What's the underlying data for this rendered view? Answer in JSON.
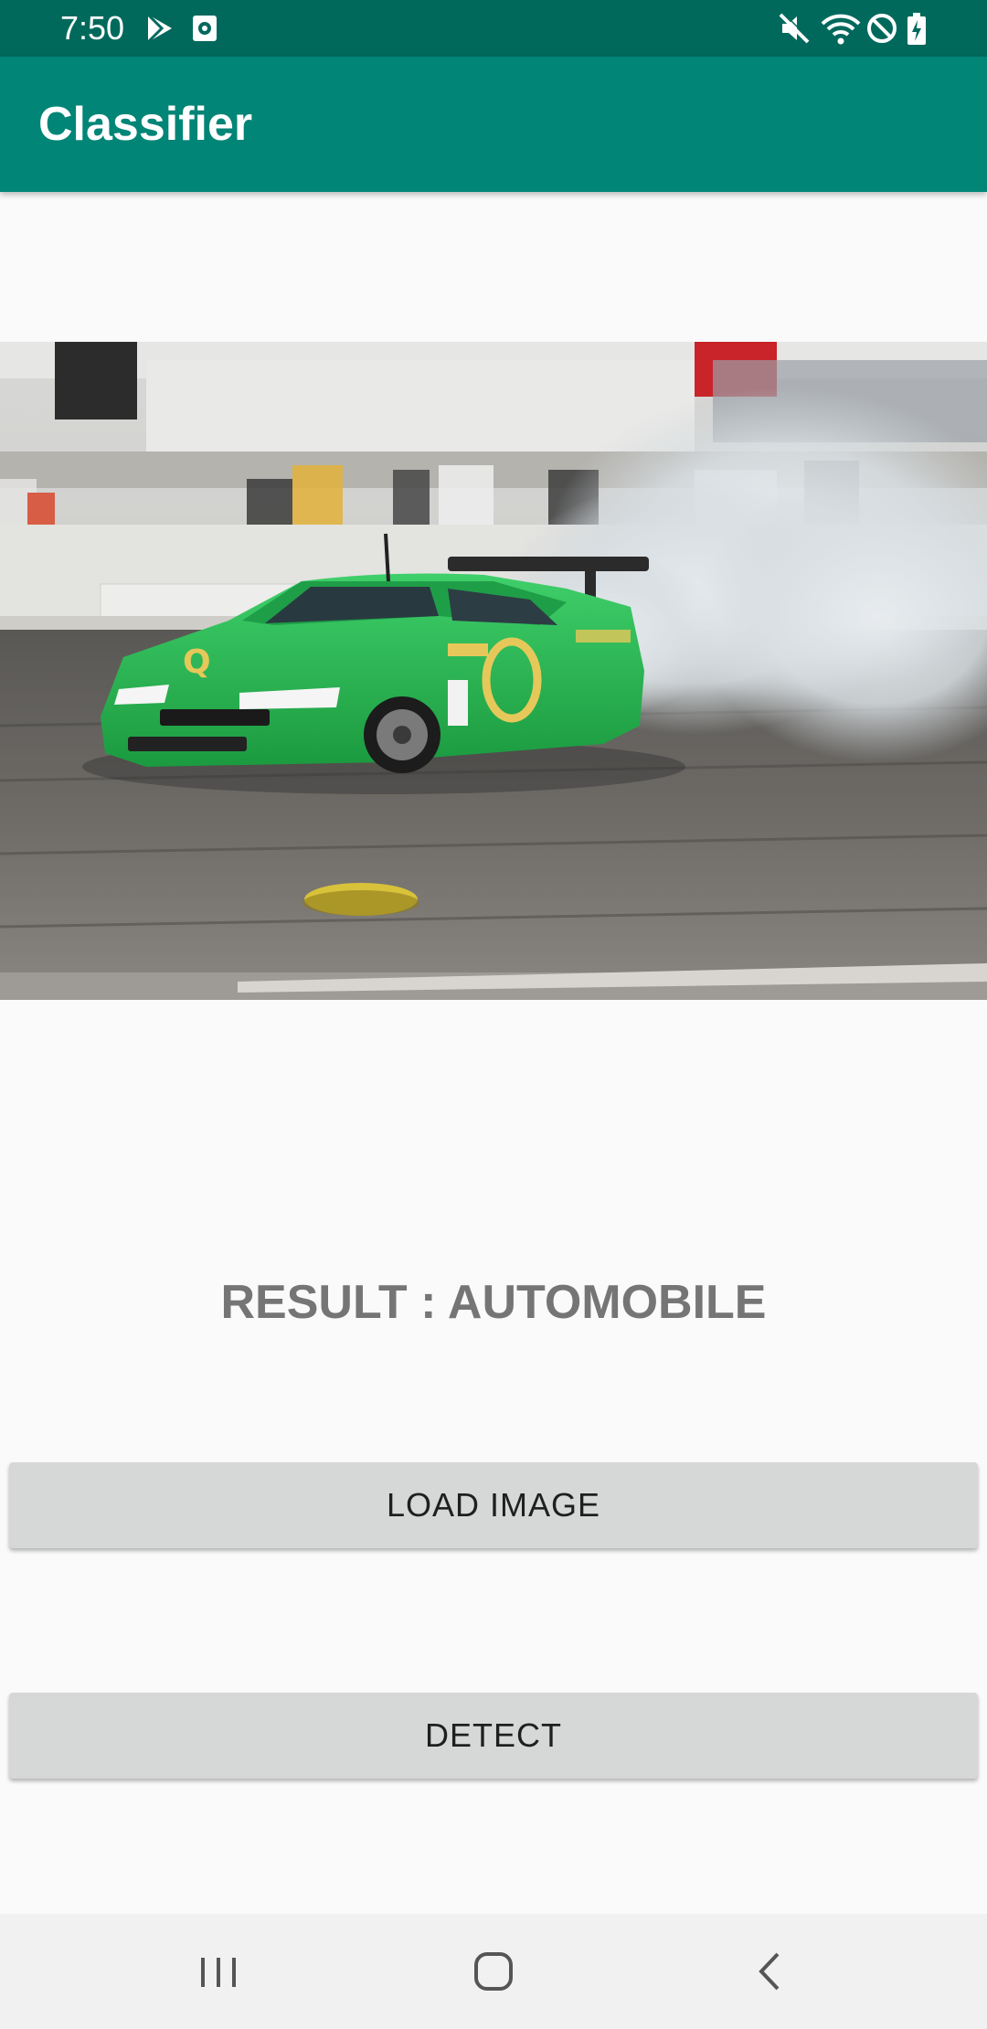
{
  "status_bar": {
    "time": "7:50",
    "left_icons": [
      "play-store-icon",
      "screen-record-icon"
    ],
    "right_icons": [
      "mute-icon",
      "wifi-icon",
      "do-not-disturb-icon",
      "battery-charging-icon"
    ]
  },
  "app_bar": {
    "title": "Classifier",
    "color": "#008577",
    "status_color": "#00695c"
  },
  "image": {
    "description_icon": "photo-race-car-drifting"
  },
  "result": {
    "text": "RESULT : AUTOMOBILE"
  },
  "buttons": {
    "load_image": "LOAD IMAGE",
    "detect": "DETECT"
  },
  "nav_bar": {
    "icons": [
      "recent-apps-icon",
      "home-icon",
      "back-icon"
    ]
  }
}
